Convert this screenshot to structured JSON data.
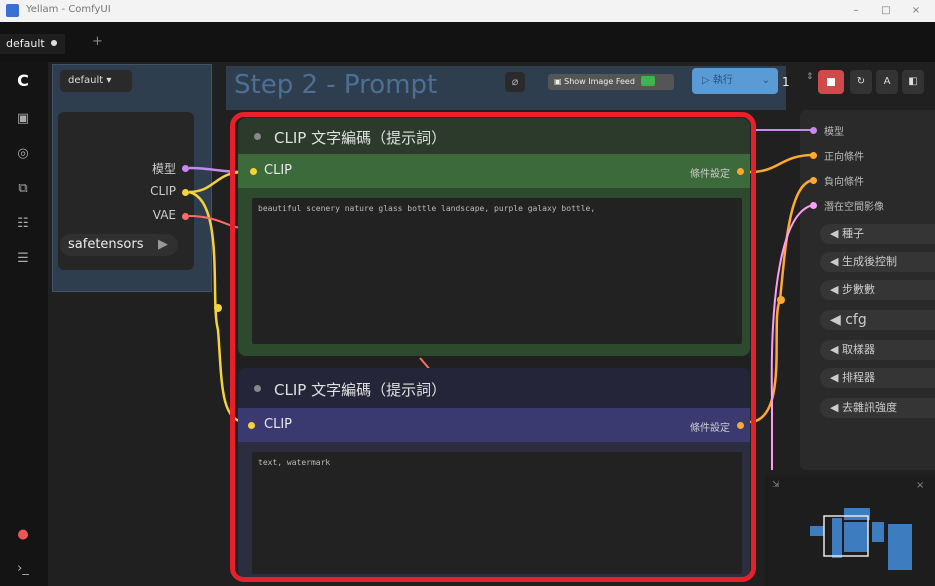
{
  "window": {
    "title": "Yellam - ComfyUI",
    "minimize": "–",
    "maximize": "□",
    "close": "×"
  },
  "tabs": [
    {
      "label": "default"
    }
  ],
  "add_tab": "+",
  "toolbar": {
    "workflow_select": "default ▾",
    "group_title": "Step 2 - Prompt",
    "show_image_feed": "Show Image Feed",
    "queue_label": "▷ 執行",
    "queue_chevron": "⌄",
    "batch_count": "1"
  },
  "left_node": {
    "outputs": [
      "模型",
      "CLIP",
      "VAE"
    ],
    "ckpt_value": "safetensors"
  },
  "clip_positive": {
    "title": "CLIP 文字編碼（提示詞）",
    "input": "CLIP",
    "output": "條件設定",
    "text": "beautiful scenery nature glass bottle landscape, purple galaxy bottle,"
  },
  "clip_negative": {
    "title": "CLIP 文字編碼（提示詞）",
    "input": "CLIP",
    "output": "條件設定",
    "text": "text, watermark"
  },
  "ksampler": {
    "inputs": [
      "模型",
      "正向條件",
      "負向條件",
      "潛在空間影像"
    ],
    "widgets": [
      "種子",
      "生成後控制",
      "步數數",
      "cfg",
      "取樣器",
      "排程器",
      "去雜訊強度"
    ]
  },
  "colors": {
    "model": "#c58af0",
    "clip": "#f5d23c",
    "vae": "#ff6b6b",
    "conditioning": "#ffa931",
    "latent": "#ff9cf9",
    "highlight": "#e8202c",
    "group_title": "#4d6f94"
  },
  "icons": [
    "comfy-logo-icon",
    "images-icon",
    "models-icon",
    "nodes-icon",
    "workflows-icon",
    "templates-icon",
    "github-icon",
    "console-icon"
  ]
}
